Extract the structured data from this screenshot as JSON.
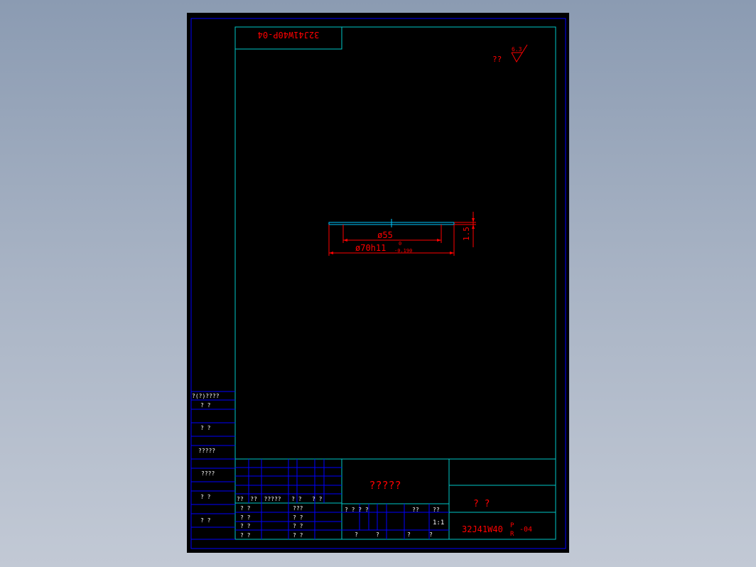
{
  "colors": {
    "background": "#000000",
    "outer_border": "#0000ff",
    "frame": "#00c8c8",
    "grid": "#0000ff",
    "white_text": "#ffffff",
    "red": "#ff0000",
    "part": "#00c8ff"
  },
  "drawing": {
    "top_code": "32J41W40P-04",
    "roughness": {
      "text": "??",
      "value": "6.3"
    },
    "dim_inner": "ø55",
    "dim_outer": "ø70h11",
    "dim_outer_tol_upper": "0",
    "dim_outer_tol_lower": "-0.190",
    "dim_thickness": "1.5"
  },
  "left_column": {
    "header": "?(?)????",
    "rows": [
      "?  ?",
      "?  ?",
      "?????",
      "????",
      "?  ?",
      "?  ?"
    ]
  },
  "title_block": {
    "name": "?????",
    "company": "?    ?",
    "sign_header": "??  ??  ?????   ? ?   ? ?",
    "sign_rows": [
      "? ?",
      "? ?",
      "? ?",
      "? ?"
    ],
    "sign_rows_mid": [
      "???",
      "? ?",
      "? ?",
      "? ?"
    ],
    "stage_header": "? ? ? ?",
    "weight": "??",
    "scale_label": "??",
    "scale": "1:1",
    "sheet_a": "?",
    "sheet_b": "?",
    "sheet_c": "?",
    "sheet_d": "?",
    "code_main": "32J41W40",
    "code_sup": "P",
    "code_sub": "R",
    "code_tail": "-04"
  }
}
